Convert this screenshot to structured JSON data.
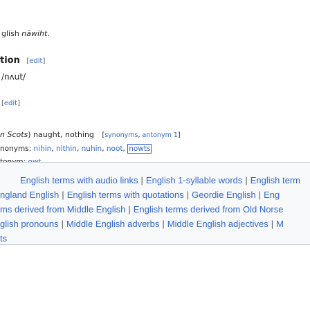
{
  "top_glyphs": "˜ ˜ ˜",
  "etym": {
    "prefix": "glish ",
    "word": "nāwiht",
    "suffix": "."
  },
  "pronunciation": {
    "heading_tail": "tion",
    "edit_label": "edit",
    "ipa": "/nʌut/"
  },
  "noun_edit": {
    "edit_label": "edit"
  },
  "definition": {
    "scope": "n Scots",
    "gloss": ") naught, nothing",
    "synonyms_link": "synonyms",
    "antonym_link": "antonym",
    "antonym_count": "1",
    "synonyms_prefix": "nonyms:",
    "synonyms": [
      "nihin",
      "nithin",
      "nuhin",
      "noot",
      "nowts"
    ],
    "antonym_prefix": "tonym:",
    "antonym": "owt"
  },
  "categories": {
    "line1": [
      "English terms with audio links",
      "English 1-syllable words",
      "English term"
    ],
    "line2": [
      "ngland English",
      "English terms with quotations",
      "Geordie English",
      "Eng"
    ],
    "line3": [
      "ms derived from Middle English",
      "English terms derived from Old Norse"
    ],
    "line4": [
      "glish pronouns",
      "Middle English adverbs",
      "Middle English adjectives",
      "M"
    ],
    "line5": [
      "ts"
    ]
  }
}
